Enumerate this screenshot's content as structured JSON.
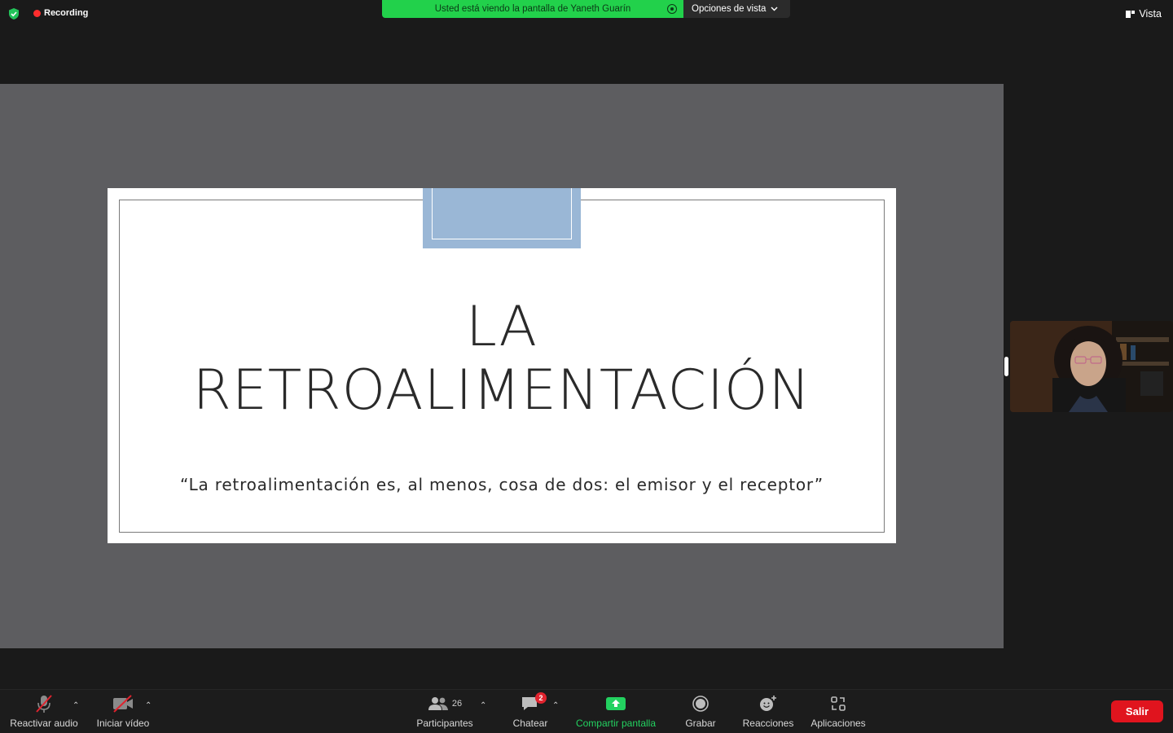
{
  "topbar": {
    "recording_label": "Recording",
    "banner_text": "Usted está viendo la pantalla de Yaneth Guarín",
    "view_options_label": "Opciones de vista",
    "view_label": "Vista"
  },
  "slide": {
    "title_line1": "LA",
    "title_line2": "RETROALIMENTACIÓN",
    "quote": "“La retroalimentación es, al menos, cosa de dos: el emisor y el receptor”",
    "accent_color": "#9ab7d6"
  },
  "toolbar": {
    "unmute_label": "Reactivar audio",
    "start_video_label": "Iniciar vídeo",
    "participants_label": "Participantes",
    "participants_count": "26",
    "chat_label": "Chatear",
    "chat_badge": "2",
    "share_label": "Compartir pantalla",
    "record_label": "Grabar",
    "reactions_label": "Reacciones",
    "apps_label": "Aplicaciones",
    "leave_label": "Salir"
  },
  "colors": {
    "share_green": "#22d14b",
    "leave_red": "#e0141e",
    "badge_red": "#e0232e"
  }
}
